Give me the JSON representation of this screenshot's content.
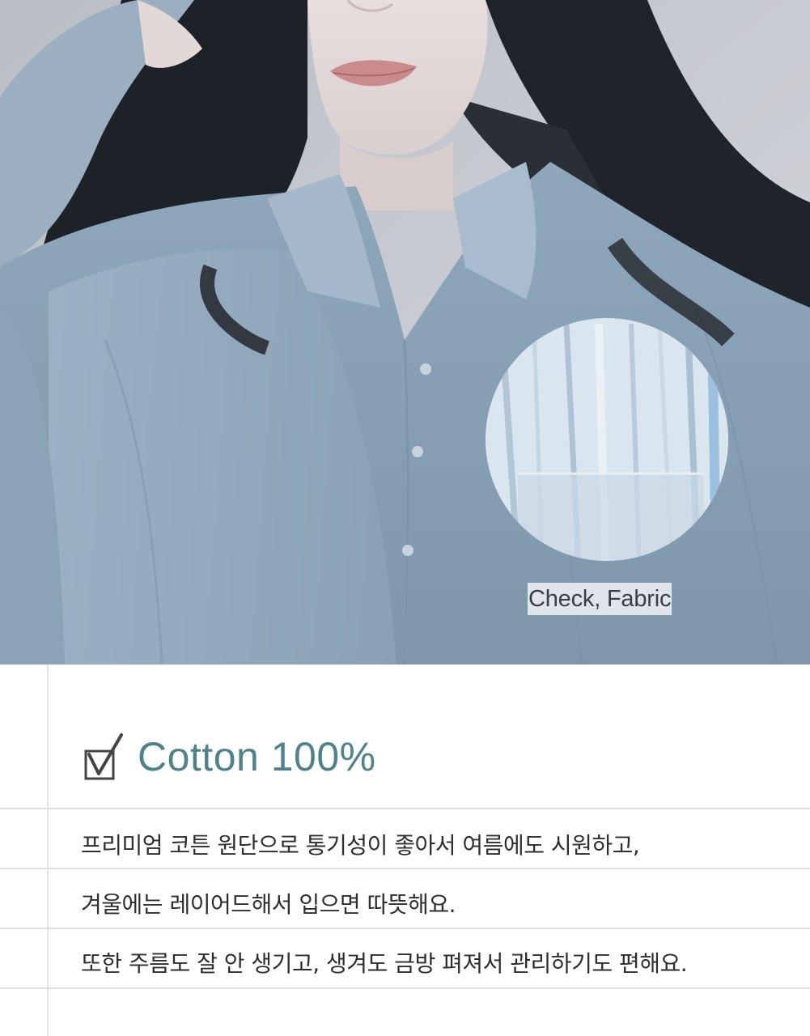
{
  "photo": {
    "caption": "Check, Fabric"
  },
  "feature": {
    "heading": "Cotton 100%",
    "icon": "checkbox-checked-icon",
    "accent_color": "#4f8389",
    "lines": [
      "프리미엄 코튼 원단으로 통기성이 좋아서 여름에도 시원하고,",
      "겨울에는 레이어드해서 입으면 따뜻해요.",
      "또한 주름도 잘 안 생기고, 생겨도 금방 펴져서 관리하기도 편해요."
    ]
  }
}
